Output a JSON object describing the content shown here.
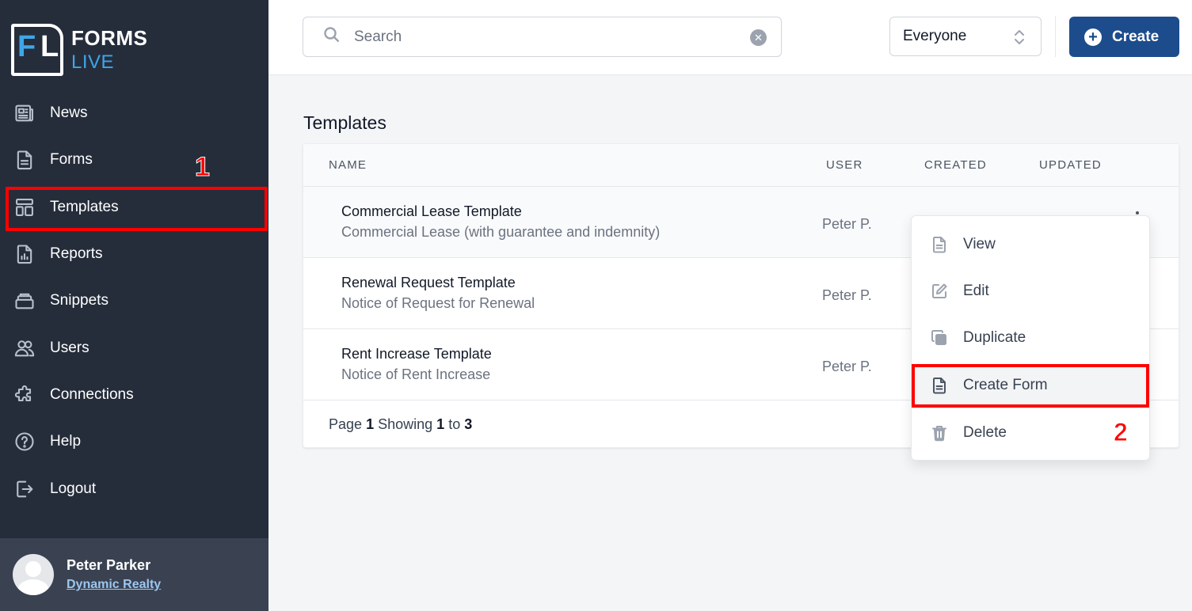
{
  "brand": {
    "logo_letters_1": "F",
    "logo_letters_2": "L",
    "name_line1": "FORMS",
    "name_line2": "LIVE",
    "accent_color": "#3ea6e8"
  },
  "sidebar": {
    "items": [
      {
        "label": "News",
        "icon": "newspaper-icon"
      },
      {
        "label": "Forms",
        "icon": "document-icon"
      },
      {
        "label": "Templates",
        "icon": "template-icon"
      },
      {
        "label": "Reports",
        "icon": "report-icon"
      },
      {
        "label": "Snippets",
        "icon": "stack-icon"
      },
      {
        "label": "Users",
        "icon": "users-icon"
      },
      {
        "label": "Connections",
        "icon": "puzzle-icon"
      },
      {
        "label": "Help",
        "icon": "help-icon"
      },
      {
        "label": "Logout",
        "icon": "logout-icon"
      }
    ],
    "active": "Templates"
  },
  "user": {
    "name": "Peter Parker",
    "org": "Dynamic Realty"
  },
  "topbar": {
    "search_placeholder": "Search",
    "filter_value": "Everyone",
    "create_label": "Create",
    "primary_color": "#1c4c8c"
  },
  "main": {
    "title": "Templates",
    "columns": {
      "name": "NAME",
      "user": "USER",
      "created": "CREATED",
      "updated": "UPDATED"
    },
    "rows": [
      {
        "name": "Commercial Lease Template",
        "description": "Commercial Lease (with guarantee and indemnity)",
        "user": "Peter P."
      },
      {
        "name": "Renewal Request Template",
        "description": "Notice of Request for Renewal",
        "user": "Peter P."
      },
      {
        "name": "Rent Increase Template",
        "description": "Notice of Rent Increase",
        "user": "Peter P."
      }
    ],
    "footer": {
      "page_label": "Page",
      "page": "1",
      "showing_label": "Showing",
      "from": "1",
      "to_label": "to",
      "to": "3"
    }
  },
  "context_menu": {
    "items": [
      {
        "label": "View",
        "icon": "document-icon"
      },
      {
        "label": "Edit",
        "icon": "edit-icon"
      },
      {
        "label": "Duplicate",
        "icon": "duplicate-icon"
      },
      {
        "label": "Create Form",
        "icon": "document-icon"
      },
      {
        "label": "Delete",
        "icon": "trash-icon"
      }
    ]
  },
  "annotations": {
    "step1": "1",
    "step2": "2",
    "highlight_color": "#ff0000"
  }
}
